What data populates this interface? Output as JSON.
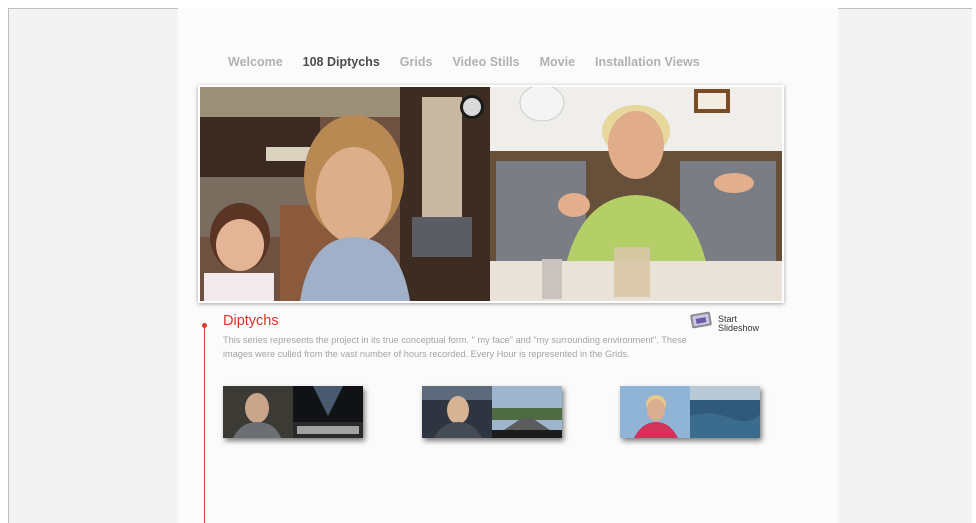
{
  "nav": {
    "items": [
      {
        "label": "Welcome",
        "active": false
      },
      {
        "label": "108 Diptychs",
        "active": true
      },
      {
        "label": "Grids",
        "active": false
      },
      {
        "label": "Video Stills",
        "active": false
      },
      {
        "label": "Movie",
        "active": false
      },
      {
        "label": "Installation Views",
        "active": false
      }
    ]
  },
  "slideshow": {
    "line1": "Start",
    "line2": "Slideshow"
  },
  "section": {
    "title": "Diptychs",
    "description": "This series represents the project in its true conceptual form. \" my face\" and \"my surrounding environment\". These images were culled from the vast number of hours recorded. Every Hour is represented in the Grids."
  },
  "colors": {
    "accent": "#d8352a",
    "nav_active": "#4c4c4c",
    "nav_inactive": "#b1b1b1"
  }
}
